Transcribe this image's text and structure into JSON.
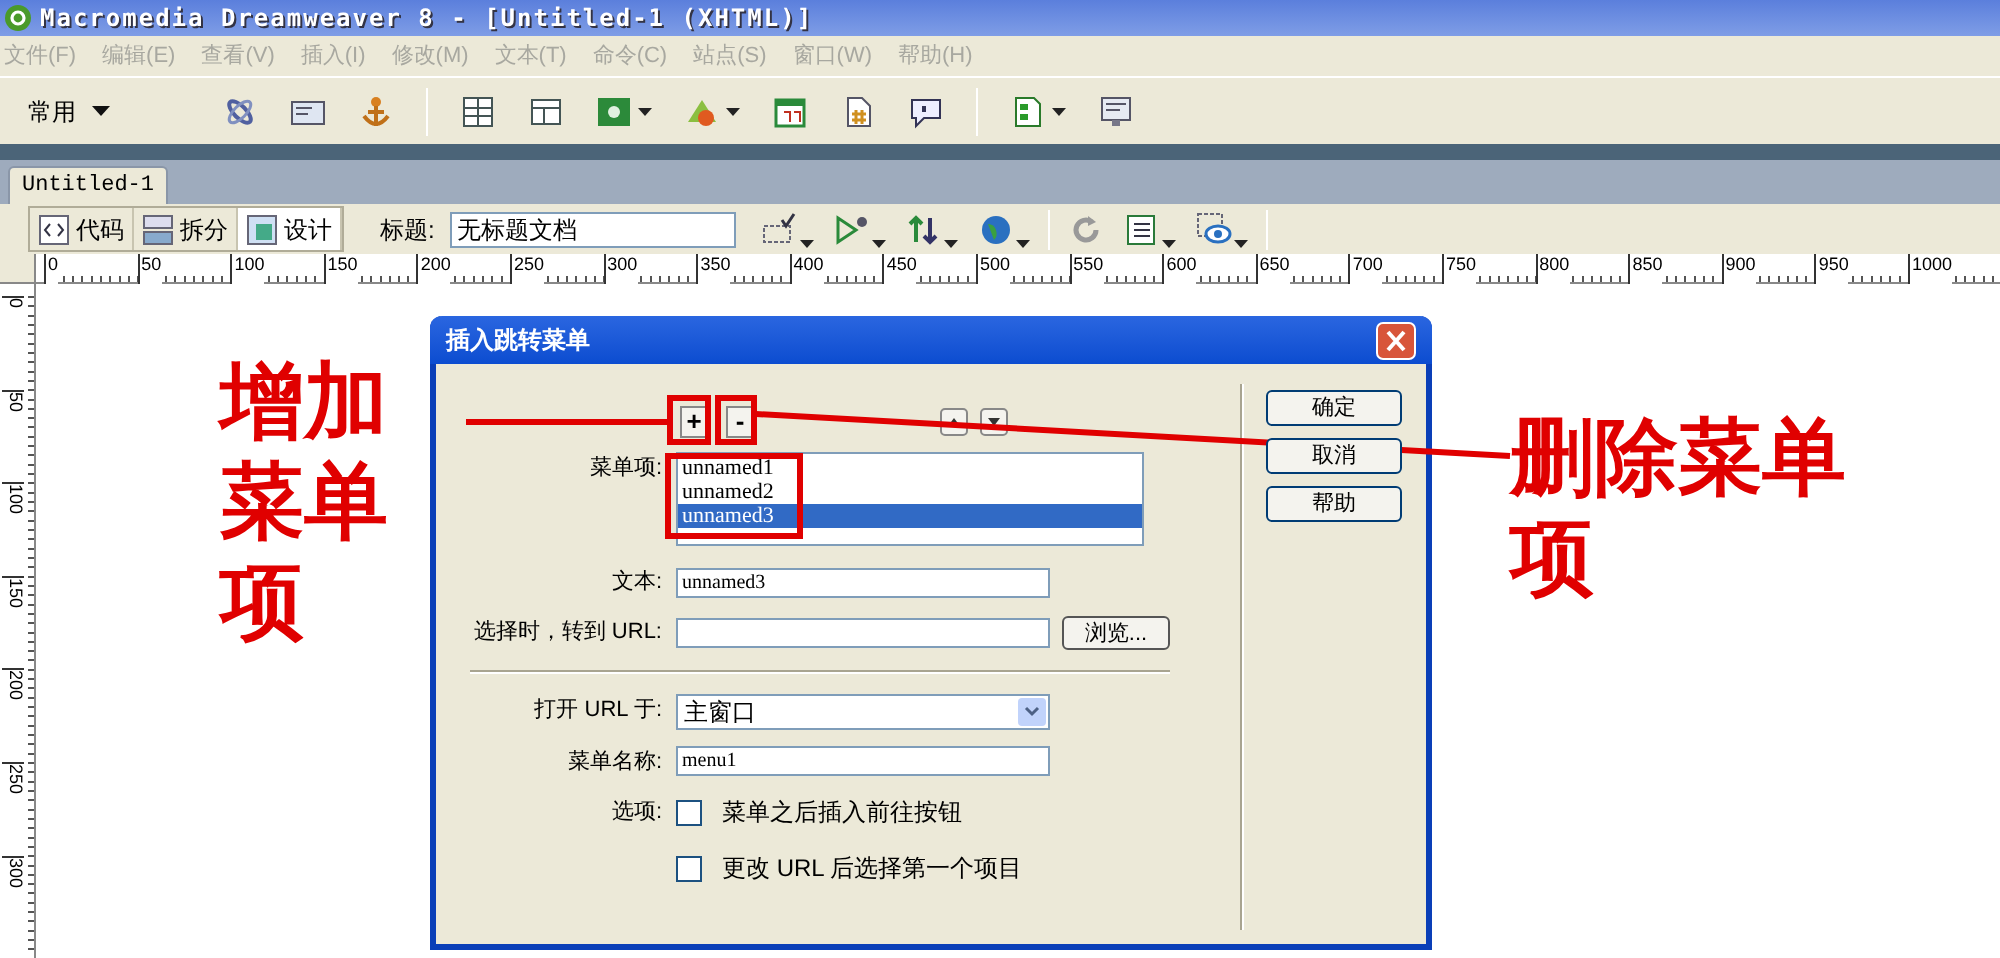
{
  "window": {
    "title": "Macromedia Dreamweaver 8 - [Untitled-1 (XHTML)]"
  },
  "menu": [
    {
      "label": "文件(F)",
      "disabled": true
    },
    {
      "label": "编辑(E)",
      "disabled": true
    },
    {
      "label": "查看(V)",
      "disabled": true
    },
    {
      "label": "插入(I)",
      "disabled": true
    },
    {
      "label": "修改(M)",
      "disabled": true
    },
    {
      "label": "文本(T)",
      "disabled": true
    },
    {
      "label": "命令(C)",
      "disabled": true
    },
    {
      "label": "站点(S)",
      "disabled": true
    },
    {
      "label": "窗口(W)",
      "disabled": true
    },
    {
      "label": "帮助(H)",
      "disabled": true
    }
  ],
  "insert_bar": {
    "category": "常用"
  },
  "document_tabs": [
    {
      "label": "Untitled-1",
      "selected": true
    }
  ],
  "view_buttons": [
    {
      "label": "代码",
      "selected": false
    },
    {
      "label": "拆分",
      "selected": false
    },
    {
      "label": "设计",
      "selected": true
    }
  ],
  "page_title": {
    "label": "标题:",
    "value": "无标题文档"
  },
  "ruler": {
    "horizontal": [
      "0",
      "50",
      "100",
      "150",
      "200",
      "250",
      "300",
      "350",
      "400",
      "450",
      "500",
      "550",
      "600",
      "650",
      "700",
      "750",
      "800",
      "850",
      "900",
      "950",
      "1000"
    ],
    "vertical": [
      "0",
      "50",
      "100",
      "150",
      "200",
      "250",
      "300"
    ]
  },
  "dialog": {
    "title": "插入跳转菜单",
    "list_buttons": [
      "+",
      "-"
    ],
    "menu_items_label": "菜单项:",
    "menu_items": [
      {
        "label": "unnamed1",
        "selected": false
      },
      {
        "label": "unnamed2",
        "selected": false
      },
      {
        "label": "unnamed3",
        "selected": true
      }
    ],
    "fields": [
      {
        "kind": "text",
        "label": "文本:",
        "value": "unnamed3"
      },
      {
        "kind": "browse",
        "label": "选择时，转到 URL:",
        "button": "浏览..."
      },
      {
        "kind": "separator"
      },
      {
        "kind": "select",
        "label": "打开 URL 于:",
        "value": "主窗口"
      },
      {
        "kind": "text",
        "label": "菜单名称:",
        "value": "menu1"
      }
    ],
    "options_label": "选项:",
    "options": [
      {
        "label": "菜单之后插入前往按钮",
        "checked": false
      },
      {
        "label": "更改 URL 后选择第一个项目",
        "checked": false
      }
    ],
    "buttons": [
      "确定",
      "取消",
      "帮助"
    ]
  },
  "annotations": [
    {
      "kind": "add",
      "text": "增加菜单项"
    },
    {
      "kind": "remove",
      "text": "删除菜单项"
    }
  ]
}
